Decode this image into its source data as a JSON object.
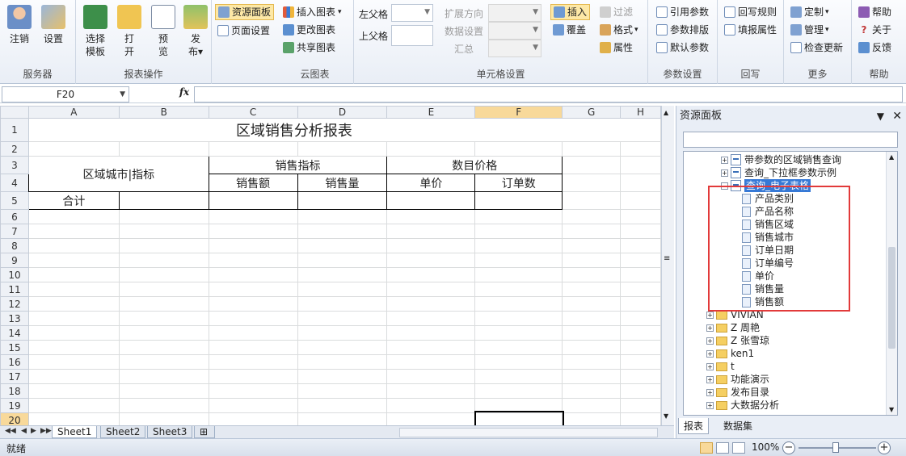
{
  "ribbon": {
    "server": {
      "label": "服务器",
      "logout": "注销",
      "settings": "设置"
    },
    "report_ops": {
      "label": "报表操作",
      "choose_template": [
        "选择",
        "模板"
      ],
      "open": [
        "打",
        "开"
      ],
      "preview": [
        "预",
        "览"
      ],
      "publish": [
        "发",
        "布"
      ]
    },
    "panel_group": {
      "resource_panel": "资源面板",
      "page_setup": "页面设置"
    },
    "cloud_chart": {
      "label": "云图表",
      "insert_chart": "插入图表",
      "change_chart": "更改图表",
      "share_chart": "共享图表"
    },
    "cell_settings": {
      "label": "单元格设置",
      "left_parent": "左父格",
      "top_parent": "上父格",
      "expand_dir": "扩展方向",
      "data_settings": "数据设置",
      "summary": "汇总",
      "insert": "插入",
      "cover": "覆盖",
      "filter": "过滤",
      "format": "格式",
      "properties": "属性"
    },
    "param_settings": {
      "label": "参数设置",
      "ref_param": "引用参数",
      "param_layout": "参数排版",
      "default_param": "默认参数"
    },
    "writeback": {
      "label": "回写",
      "rule": "回写规则",
      "fill_props": "填报属性"
    },
    "more": {
      "label": "更多",
      "customize": "定制",
      "manage": "管理",
      "check_update": "检查更新"
    },
    "help": {
      "label": "帮助",
      "help": "帮助",
      "about": "关于",
      "feedback": "反馈"
    }
  },
  "formula_bar": {
    "cell_ref": "F20",
    "fx": "fx",
    "value": ""
  },
  "sheet": {
    "columns": [
      "A",
      "B",
      "C",
      "D",
      "E",
      "F",
      "G",
      "H"
    ],
    "selected_column": "F",
    "rows": [
      "1",
      "2",
      "3",
      "4",
      "5",
      "6",
      "7",
      "8",
      "9",
      "10",
      "11",
      "12",
      "13",
      "14",
      "15",
      "16",
      "17",
      "18",
      "19",
      "20"
    ],
    "selected_row": "20",
    "title": "区域销售分析报表",
    "region_header": "区域城市|指标",
    "sales_metrics": "销售指标",
    "item_price": "数目价格",
    "sales_amount": "销售额",
    "sales_qty": "销售量",
    "unit_price": "单价",
    "order_count": "订单数",
    "total": "合计"
  },
  "sheet_tabs": [
    "Sheet1",
    "Sheet2",
    "Sheet3"
  ],
  "panel": {
    "title": "资源面板",
    "search_value": "",
    "tree": [
      {
        "label": "带参数的区域销售查询",
        "kind": "report",
        "indent": 1,
        "exp": "+"
      },
      {
        "label": "查询_下拉框参数示例",
        "kind": "report",
        "indent": 1,
        "exp": "+"
      },
      {
        "label": "查询_电子表格",
        "kind": "report",
        "indent": 1,
        "exp": "-",
        "selected": true
      },
      {
        "label": "产品类别",
        "kind": "field",
        "indent": 2
      },
      {
        "label": "产品名称",
        "kind": "field",
        "indent": 2
      },
      {
        "label": "销售区域",
        "kind": "field",
        "indent": 2
      },
      {
        "label": "销售城市",
        "kind": "field",
        "indent": 2
      },
      {
        "label": "订单日期",
        "kind": "field",
        "indent": 2
      },
      {
        "label": "订单编号",
        "kind": "field",
        "indent": 2
      },
      {
        "label": "单价",
        "kind": "field",
        "indent": 2
      },
      {
        "label": "销售量",
        "kind": "field",
        "indent": 2
      },
      {
        "label": "销售额",
        "kind": "field",
        "indent": 2
      },
      {
        "label": "VIVIAN",
        "kind": "folder",
        "indent": 0,
        "exp": "+"
      },
      {
        "label": "Z 周艳",
        "kind": "folder",
        "indent": 0,
        "exp": "+"
      },
      {
        "label": "Z 张雪琼",
        "kind": "folder",
        "indent": 0,
        "exp": "+"
      },
      {
        "label": "ken1",
        "kind": "folder",
        "indent": 0,
        "exp": "+"
      },
      {
        "label": "t",
        "kind": "folder",
        "indent": 0,
        "exp": "+"
      },
      {
        "label": "功能演示",
        "kind": "folder",
        "indent": 0,
        "exp": "+"
      },
      {
        "label": "发布目录",
        "kind": "folder",
        "indent": 0,
        "exp": "+"
      },
      {
        "label": "大数据分析",
        "kind": "folder",
        "indent": 0,
        "exp": "+"
      }
    ],
    "tabs": [
      "报表",
      "数据集"
    ]
  },
  "status": {
    "text": "就绪",
    "zoom": "100%"
  },
  "colors": {
    "accent": "#3679d6",
    "highlight_box": "#e23a3a",
    "selected_header": "#f8d99a"
  }
}
